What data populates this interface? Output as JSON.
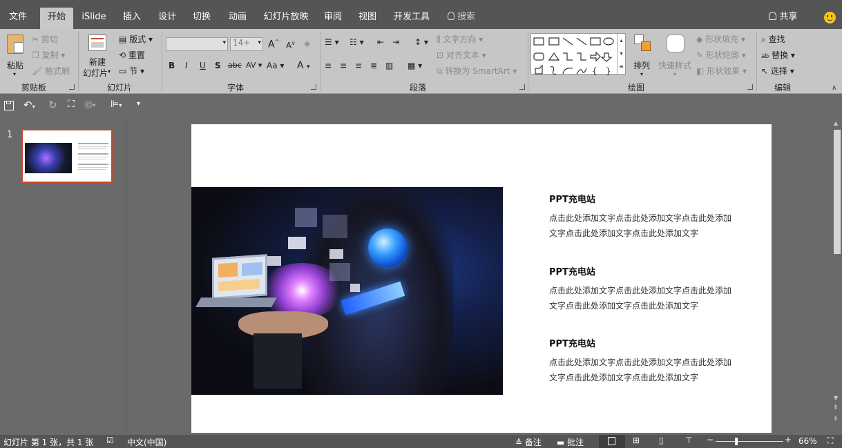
{
  "tabs": {
    "file": "文件",
    "home": "开始",
    "islide": "iSlide",
    "insert": "插入",
    "design": "设计",
    "transitions": "切换",
    "animations": "动画",
    "slideshow": "幻灯片放映",
    "review": "审阅",
    "view": "视图",
    "developer": "开发工具",
    "tell_me": "搜索",
    "share": "共享"
  },
  "ribbon": {
    "clipboard": {
      "paste": "粘贴",
      "cut": "剪切",
      "copy": "复制",
      "format_painter": "格式刷",
      "label": "剪贴板"
    },
    "slides": {
      "new_slide_1": "新建",
      "new_slide_2": "幻灯片",
      "layout": "版式",
      "reset": "重置",
      "section": "节",
      "label": "幻灯片"
    },
    "font": {
      "font_name": "",
      "font_size": "14+",
      "bold": "B",
      "italic": "I",
      "underline": "U",
      "shadow": "S",
      "strike": "abc",
      "spacing": "AV",
      "case": "Aa",
      "color": "A",
      "grow": "A",
      "shrink": "A",
      "label": "字体"
    },
    "paragraph": {
      "text_direction": "文字方向",
      "align_text": "对齐文本",
      "smartart": "转换为 SmartArt",
      "label": "段落"
    },
    "drawing": {
      "arrange": "排列",
      "quick_styles": "快速样式",
      "shape_fill": "形状填充",
      "shape_outline": "形状轮廓",
      "shape_effects": "形状效果",
      "label": "绘图"
    },
    "editing": {
      "find": "查找",
      "replace": "替换",
      "select": "选择",
      "label": "编辑"
    }
  },
  "thumbnail": {
    "number": "1"
  },
  "slide": {
    "blocks": [
      {
        "title": "PPT充电站",
        "line1": "点击此处添加文字点击此处添加文字点击此处添加",
        "line2": "文字点击此处添加文字点击此处添加文字"
      },
      {
        "title": "PPT充电站",
        "line1": "点击此处添加文字点击此处添加文字点击此处添加",
        "line2": "文字点击此处添加文字点击此处添加文字"
      },
      {
        "title": "PPT充电站",
        "line1": "点击此处添加文字点击此处添加文字点击此处添加",
        "line2": "文字点击此处添加文字点击此处添加文字"
      }
    ]
  },
  "status": {
    "slide_info": "幻灯片 第 1 张，共 1 张",
    "language": "中文(中国)",
    "notes": "备注",
    "comments": "批注",
    "zoom": "66%"
  },
  "colors": {
    "accent": "#d24726",
    "tabbar": "#555555",
    "ribbon": "#c6c6c6"
  }
}
